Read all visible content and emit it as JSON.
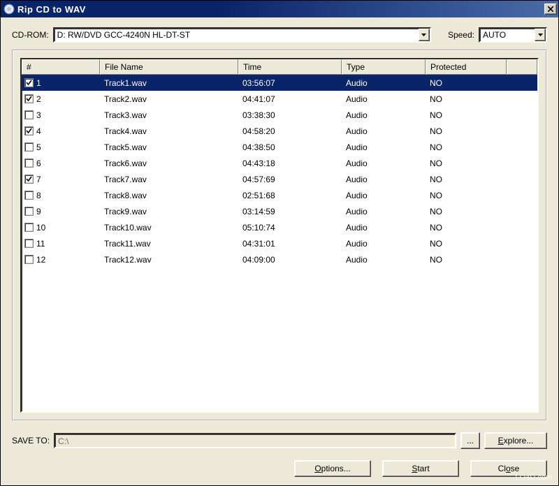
{
  "window": {
    "title": "Rip CD to WAV"
  },
  "top": {
    "cdrom_label": "CD-ROM:",
    "cdrom_value": "D: RW/DVD GCC-4240N HL-DT-ST",
    "speed_label": "Speed:",
    "speed_value": "AUTO"
  },
  "columns": {
    "num": "#",
    "filename": "File Name",
    "time": "Time",
    "type": "Type",
    "protected": "Protected"
  },
  "tracks": [
    {
      "checked": true,
      "num": "1",
      "filename": "Track1.wav",
      "time": "03:56:07",
      "type": "Audio",
      "protected": "NO",
      "selected": true
    },
    {
      "checked": true,
      "num": "2",
      "filename": "Track2.wav",
      "time": "04:41:07",
      "type": "Audio",
      "protected": "NO",
      "selected": false
    },
    {
      "checked": false,
      "num": "3",
      "filename": "Track3.wav",
      "time": "03:38:30",
      "type": "Audio",
      "protected": "NO",
      "selected": false
    },
    {
      "checked": true,
      "num": "4",
      "filename": "Track4.wav",
      "time": "04:58:20",
      "type": "Audio",
      "protected": "NO",
      "selected": false
    },
    {
      "checked": false,
      "num": "5",
      "filename": "Track5.wav",
      "time": "04:38:50",
      "type": "Audio",
      "protected": "NO",
      "selected": false
    },
    {
      "checked": false,
      "num": "6",
      "filename": "Track6.wav",
      "time": "04:43:18",
      "type": "Audio",
      "protected": "NO",
      "selected": false
    },
    {
      "checked": true,
      "num": "7",
      "filename": "Track7.wav",
      "time": "04:57:69",
      "type": "Audio",
      "protected": "NO",
      "selected": false
    },
    {
      "checked": false,
      "num": "8",
      "filename": "Track8.wav",
      "time": "02:51:68",
      "type": "Audio",
      "protected": "NO",
      "selected": false
    },
    {
      "checked": false,
      "num": "9",
      "filename": "Track9.wav",
      "time": "03:14:59",
      "type": "Audio",
      "protected": "NO",
      "selected": false
    },
    {
      "checked": false,
      "num": "10",
      "filename": "Track10.wav",
      "time": "05:10:74",
      "type": "Audio",
      "protected": "NO",
      "selected": false
    },
    {
      "checked": false,
      "num": "11",
      "filename": "Track11.wav",
      "time": "04:31:01",
      "type": "Audio",
      "protected": "NO",
      "selected": false
    },
    {
      "checked": false,
      "num": "12",
      "filename": "Track12.wav",
      "time": "04:09:00",
      "type": "Audio",
      "protected": "NO",
      "selected": false
    }
  ],
  "save": {
    "label": "SAVE TO:",
    "path": "C:\\",
    "browse": "...",
    "explore": "Explore..."
  },
  "buttons": {
    "options": "Options...",
    "start": "Start",
    "close": "Close"
  },
  "watermark": "LO4D.com"
}
